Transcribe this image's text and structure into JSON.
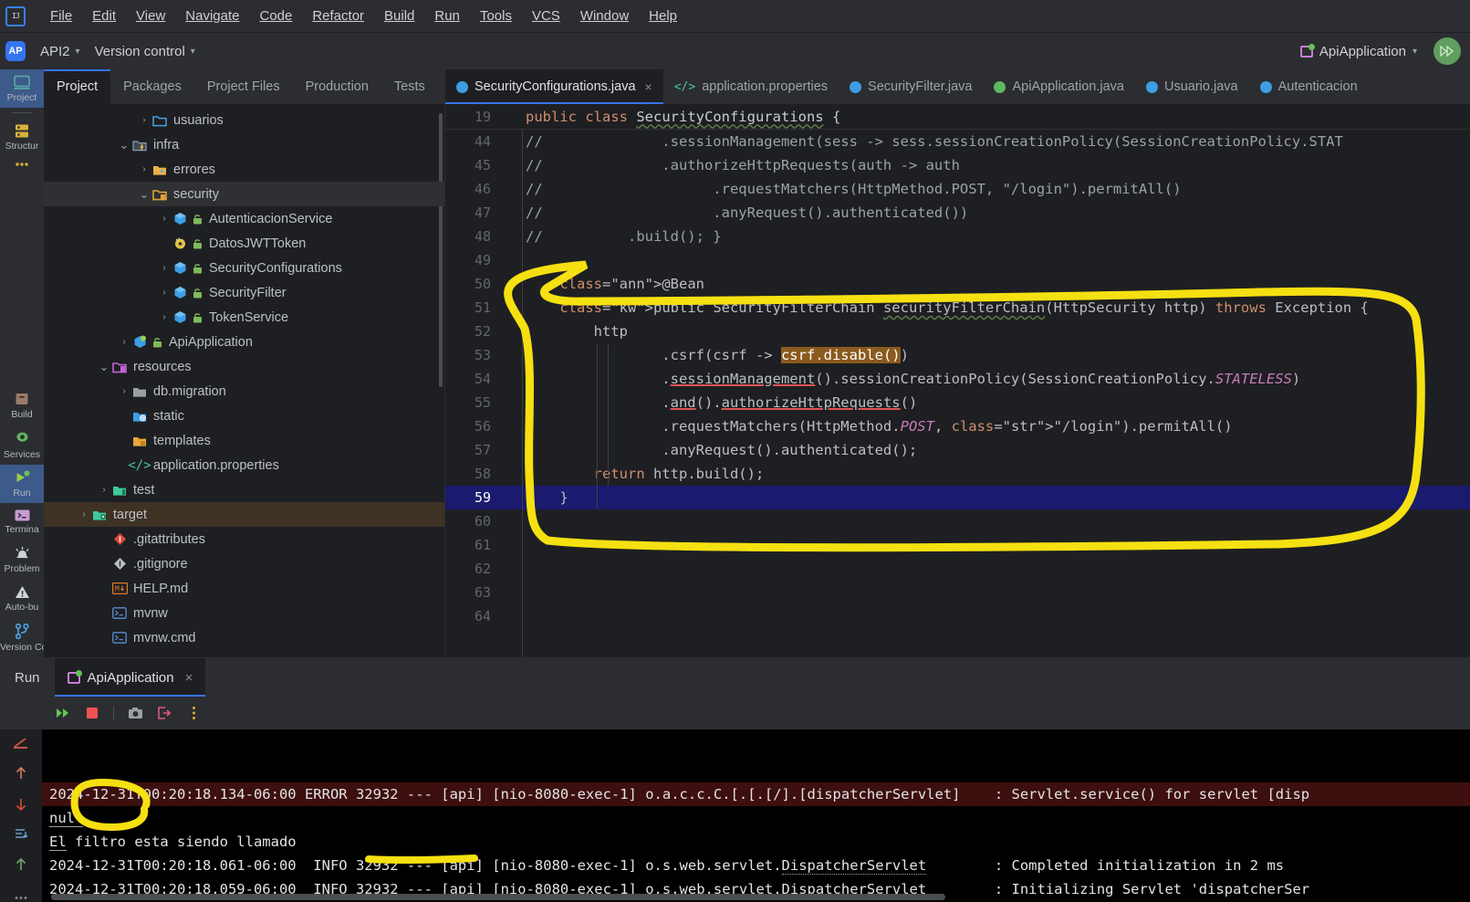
{
  "window": {
    "app": "IntelliJ IDEA",
    "project": "API2"
  },
  "menubar": {
    "logo": "IJ",
    "items": [
      "File",
      "Edit",
      "View",
      "Navigate",
      "Code",
      "Refactor",
      "Build",
      "Run",
      "Tools",
      "VCS",
      "Window",
      "Help"
    ]
  },
  "navbar": {
    "badge": "AP",
    "project_label": "API2",
    "vcs_label": "Version control",
    "run_config": "ApiApplication",
    "avatar_initials": ""
  },
  "rail": {
    "top": [
      {
        "label": "Project",
        "icon": "project-window-icon",
        "active": true
      },
      {
        "label": "Structur",
        "icon": "structure-icon",
        "active": false
      },
      {
        "label": "",
        "icon": "more-icon",
        "active": false
      }
    ],
    "bottom": [
      {
        "label": "Build",
        "icon": "build-icon",
        "active": false
      },
      {
        "label": "Services",
        "icon": "gear-icon",
        "active": false
      },
      {
        "label": "Run",
        "icon": "run-play-icon",
        "active": true
      },
      {
        "label": "Termina",
        "icon": "terminal-icon",
        "active": false
      },
      {
        "label": "Problem",
        "icon": "problems-icon",
        "active": false
      },
      {
        "label": "Auto-bu",
        "icon": "warning-icon",
        "active": false
      },
      {
        "label": "Version Control",
        "icon": "branch-icon",
        "active": false
      }
    ]
  },
  "project_panel": {
    "tabs": [
      "Project",
      "Packages",
      "Project Files",
      "Production",
      "Tests"
    ],
    "active_tab": "Project",
    "tree": [
      {
        "label": "usuarios",
        "indent": 4,
        "twist": "collapsed",
        "icon": "folder-plain",
        "state": ""
      },
      {
        "label": "infra",
        "indent": 3,
        "twist": "expanded",
        "icon": "folder-package",
        "state": ""
      },
      {
        "label": "errores",
        "indent": 4,
        "twist": "collapsed",
        "icon": "folder-yellow",
        "state": ""
      },
      {
        "label": "security",
        "indent": 4,
        "twist": "expanded",
        "icon": "folder-lock",
        "state": "selected"
      },
      {
        "label": "AutenticacionService",
        "indent": 5,
        "twist": "collapsed",
        "icon": "class-blue",
        "state": ""
      },
      {
        "label": "DatosJWTToken",
        "indent": 5,
        "twist": "none",
        "icon": "class-record",
        "state": ""
      },
      {
        "label": "SecurityConfigurations",
        "indent": 5,
        "twist": "collapsed",
        "icon": "class-blue",
        "state": ""
      },
      {
        "label": "SecurityFilter",
        "indent": 5,
        "twist": "collapsed",
        "icon": "class-blue",
        "state": ""
      },
      {
        "label": "TokenService",
        "indent": 5,
        "twist": "collapsed",
        "icon": "class-blue",
        "state": ""
      },
      {
        "label": "ApiApplication",
        "indent": 3,
        "twist": "collapsed",
        "icon": "class-spring",
        "state": ""
      },
      {
        "label": "resources",
        "indent": 2,
        "twist": "expanded",
        "icon": "folder-res",
        "state": ""
      },
      {
        "label": "db.migration",
        "indent": 3,
        "twist": "collapsed",
        "icon": "folder-grey",
        "state": ""
      },
      {
        "label": "static",
        "indent": 3,
        "twist": "none",
        "icon": "folder-static",
        "state": ""
      },
      {
        "label": "templates",
        "indent": 3,
        "twist": "none",
        "icon": "folder-tmpl",
        "state": ""
      },
      {
        "label": "application.properties",
        "indent": 3,
        "twist": "none",
        "icon": "props-icon",
        "state": ""
      },
      {
        "label": "test",
        "indent": 2,
        "twist": "collapsed",
        "icon": "folder-test",
        "state": ""
      },
      {
        "label": "target",
        "indent": 1,
        "twist": "collapsed",
        "icon": "folder-target",
        "state": "target"
      },
      {
        "label": ".gitattributes",
        "indent": 2,
        "twist": "none",
        "icon": "git-red-icon",
        "state": ""
      },
      {
        "label": ".gitignore",
        "indent": 2,
        "twist": "none",
        "icon": "git-grey-icon",
        "state": ""
      },
      {
        "label": "HELP.md",
        "indent": 2,
        "twist": "none",
        "icon": "markdown-icon",
        "state": ""
      },
      {
        "label": "mvnw",
        "indent": 2,
        "twist": "none",
        "icon": "script-icon",
        "state": ""
      },
      {
        "label": "mvnw.cmd",
        "indent": 2,
        "twist": "none",
        "icon": "script-icon",
        "state": ""
      }
    ]
  },
  "editor": {
    "tabs": [
      {
        "label": "SecurityConfigurations.java",
        "icon": "java-class-icon",
        "active": true,
        "closable": true
      },
      {
        "label": "application.properties",
        "icon": "properties-icon",
        "active": false,
        "closable": false
      },
      {
        "label": "SecurityFilter.java",
        "icon": "java-class-icon",
        "active": false,
        "closable": false
      },
      {
        "label": "ApiApplication.java",
        "icon": "spring-class-icon",
        "active": false,
        "closable": false
      },
      {
        "label": "Usuario.java",
        "icon": "java-class-icon",
        "active": false,
        "closable": false
      },
      {
        "label": "Autenticacion",
        "icon": "java-class-icon",
        "active": false,
        "closable": false
      }
    ],
    "sticky_line_number": "19",
    "sticky_line_text": "public class SecurityConfigurations {",
    "lines": [
      {
        "n": "44",
        "mark": "",
        "text": "//              .sessionManagement(sess -> sess.sessionCreationPolicy(SessionCreationPolicy.STAT"
      },
      {
        "n": "45",
        "mark": "",
        "text": "//              .authorizeHttpRequests(auth -> auth"
      },
      {
        "n": "46",
        "mark": "",
        "text": "//                    .requestMatchers(HttpMethod.POST, \"/login\").permitAll()"
      },
      {
        "n": "47",
        "mark": "",
        "text": "//                    .anyRequest().authenticated())"
      },
      {
        "n": "48",
        "mark": "",
        "text": "//          .build(); }"
      },
      {
        "n": "49",
        "mark": "",
        "text": ""
      },
      {
        "n": "50",
        "mark": "",
        "text": "    @Bean"
      },
      {
        "n": "51",
        "mark": "@",
        "text": "    public SecurityFilterChain securityFilterChain(HttpSecurity http) throws Exception {"
      },
      {
        "n": "52",
        "mark": "",
        "text": "        http"
      },
      {
        "n": "53",
        "mark": "",
        "text": "                .csrf(csrf -> csrf.disable())"
      },
      {
        "n": "54",
        "mark": "",
        "text": "                .sessionManagement().sessionCreationPolicy(SessionCreationPolicy.STATELESS)"
      },
      {
        "n": "55",
        "mark": "",
        "text": "                .and().authorizeHttpRequests()"
      },
      {
        "n": "56",
        "mark": "",
        "text": "                .requestMatchers(HttpMethod.POST, \"/login\").permitAll()"
      },
      {
        "n": "57",
        "mark": "",
        "text": "                .anyRequest().authenticated();"
      },
      {
        "n": "58",
        "mark": "",
        "text": "        return http.build();"
      },
      {
        "n": "59",
        "mark": "",
        "text": "    }",
        "selected": true
      },
      {
        "n": "60",
        "mark": "",
        "text": ""
      },
      {
        "n": "61",
        "mark": "",
        "text": ""
      },
      {
        "n": "62",
        "mark": "",
        "text": ""
      },
      {
        "n": "63",
        "mark": "",
        "text": ""
      },
      {
        "n": "64",
        "mark": "",
        "text": ""
      }
    ],
    "highlighted_token": "csrf.disable()"
  },
  "run_panel": {
    "title": "Run",
    "tab_label": "ApiApplication",
    "toolbar_icons": [
      "rerun-icon",
      "stop-icon",
      "camera-icon",
      "export-icon",
      "more-vertical-icon"
    ],
    "gutter_icons": [
      "soft-wrap-icon",
      "up-arrow-icon",
      "down-arrow-icon",
      "scroll-end-icon",
      "up-arrow-icon",
      "more-icon"
    ],
    "console": [
      {
        "text": "2024-12-31T00:20:18.059-06:00  INFO 32932 --- [api] [nio-8080-exec-1] o.s.web.servlet.DispatcherServlet        : Initializing Servlet 'dispatcherSer",
        "level": "info"
      },
      {
        "text": "2024-12-31T00:20:18.061-06:00  INFO 32932 --- [api] [nio-8080-exec-1] o.s.web.servlet.DispatcherServlet        : Completed initialization in 2 ms",
        "level": "info"
      },
      {
        "text": "El filtro esta siendo llamado",
        "level": "plain"
      },
      {
        "text": "null",
        "level": "plain"
      },
      {
        "text": "2024-12-31T00:20:18.134-06:00 ERROR 32932 --- [api] [nio-8080-exec-1] o.a.c.c.C.[.[.[/].[dispatcherServlet]    : Servlet.service() for servlet [disp",
        "level": "error"
      }
    ]
  },
  "annotations": {
    "color": "#f5e011",
    "marks": [
      "code-block-circle",
      "null-circle",
      "error-underline"
    ]
  },
  "colors": {
    "accent": "#3574f0",
    "bg": "#1e1f22",
    "panel": "#2b2d30",
    "console_bg": "#000000",
    "error_bg": "#3d0f0f",
    "highlight": "#8a5a1e",
    "selection": "#1a1a6e",
    "annotation": "#f5e011"
  }
}
